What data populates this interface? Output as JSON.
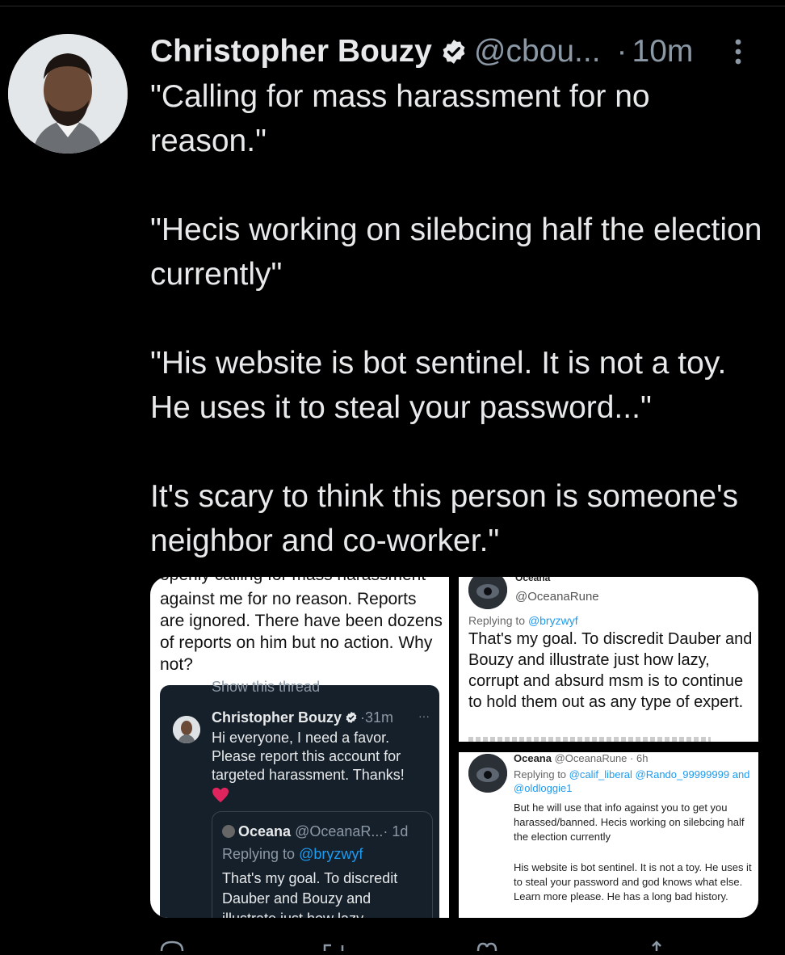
{
  "tweet": {
    "author_name": "Christopher Bouzy",
    "handle": "@cbou...",
    "separator": "·",
    "time": "10m",
    "paragraphs": [
      "\"Calling for mass harassment for no reason.\"",
      "\"Hecis working on silebcing half the election currently\"",
      "\"His website is bot sentinel. It is not a toy. He uses it to steal your password...\"",
      "It's scary to think this person is someone's neighbor and co-worker.\""
    ]
  },
  "media_left": {
    "cut_line": "openly calling for mass harassment",
    "text": "against me for no reason. Reports are ignored. There have been dozens of reports on him but no action. Why not?",
    "embedded_tweet": {
      "cut_line": "Show this thread",
      "name": "Christopher Bouzy",
      "separator": "·",
      "time": "31m",
      "more": "···",
      "body": "Hi everyone, I need a favor. Please report this account for targeted harassment. Thanks!",
      "quote": {
        "name": "Oceana",
        "handle": "@OceanaR...",
        "time": "· 1d",
        "reply_prefix": "Replying to",
        "reply_to": "@bryzwyf",
        "body": "That's my goal. To discredit Dauber and Bouzy and illustrate just how lazy,"
      }
    }
  },
  "media_top_right": {
    "name": "Oceana",
    "handle": "@OceanaRune",
    "reply_prefix": "Replying to",
    "reply_to": "@bryzwyf",
    "body": "That's my goal. To discredit Dauber and Bouzy and illustrate just how lazy, corrupt and absurd msm is to continue to hold them out as any type of expert."
  },
  "media_bottom_right": {
    "name": "Oceana",
    "handle": "@OceanaRune",
    "time": "· 6h",
    "reply_prefix": "Replying to",
    "reply_to": "@calif_liberal @Rando_99999999",
    "reply_and": "and",
    "reply_to2": "@oldloggie1",
    "body1": "But he will use that info against you to get you harassed/banned. Hecis working on silebcing half the election currently",
    "body2": "His website is bot sentinel. It is not a toy. He uses it to steal your password and god knows what else. Learn more please. He has a long bad history."
  },
  "icons": [
    "verified-badge-icon",
    "more-vertical-icon",
    "heart-emoji-icon",
    "reply-icon",
    "retweet-icon",
    "like-icon",
    "share-icon"
  ],
  "colors": {
    "background": "#000000",
    "text": "#e7e9ea",
    "muted": "#8b98a5",
    "link": "#1d9bf0",
    "card_dark": "#15202b"
  }
}
